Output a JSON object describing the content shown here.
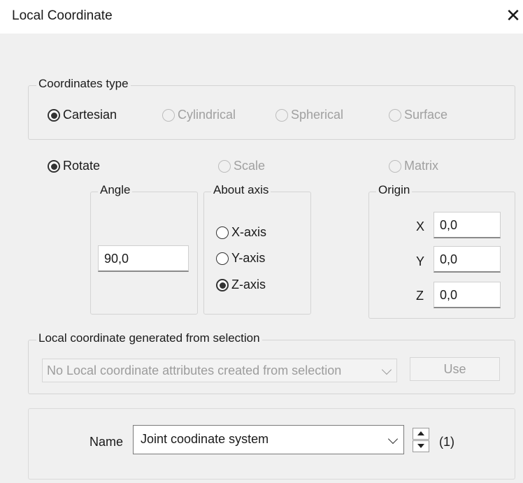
{
  "window": {
    "title": "Local Coordinate",
    "close_glyph": "✕"
  },
  "coordinates_type": {
    "legend": "Coordinates type",
    "options": [
      {
        "label": "Cartesian",
        "checked": true,
        "enabled": true
      },
      {
        "label": "Cylindrical",
        "checked": false,
        "enabled": false
      },
      {
        "label": "Spherical",
        "checked": false,
        "enabled": false
      },
      {
        "label": "Surface",
        "checked": false,
        "enabled": false
      }
    ]
  },
  "mode": {
    "options": [
      {
        "label": "Rotate",
        "checked": true,
        "enabled": true
      },
      {
        "label": "Scale",
        "checked": false,
        "enabled": false
      },
      {
        "label": "Matrix",
        "checked": false,
        "enabled": false
      }
    ]
  },
  "angle": {
    "legend": "Angle",
    "value": "90,0"
  },
  "about_axis": {
    "legend": "About axis",
    "options": [
      {
        "label": "X-axis",
        "checked": false
      },
      {
        "label": "Y-axis",
        "checked": false
      },
      {
        "label": "Z-axis",
        "checked": true
      }
    ]
  },
  "origin": {
    "legend": "Origin",
    "x_label": "X",
    "x_value": "0,0",
    "y_label": "Y",
    "y_value": "0,0",
    "z_label": "Z",
    "z_value": "0,0"
  },
  "selection": {
    "legend": "Local coordinate generated from selection",
    "combo_value": "No Local coordinate attributes created from selection",
    "use_label": "Use"
  },
  "name_section": {
    "label": "Name",
    "value": "Joint coodinate system",
    "counter": "(1)"
  }
}
